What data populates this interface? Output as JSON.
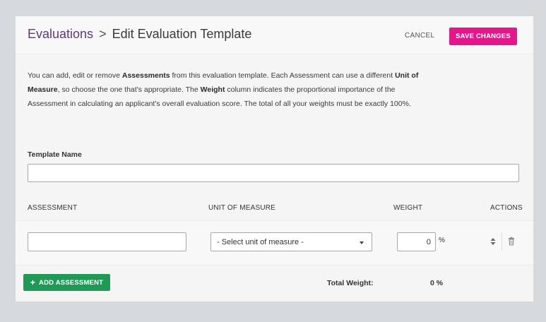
{
  "header": {
    "breadcrumb_root": "Evaluations",
    "breadcrumb_separator": ">",
    "title": "Edit Evaluation Template",
    "cancel_label": "CANCEL",
    "save_label": "SAVE CHANGES"
  },
  "description": {
    "p1": "You can add, edit or remove ",
    "b1": "Assessments",
    "p2": " from this evaluation template. Each Assessment can use a different ",
    "b2": "Unit of Measure",
    "p3": ", so choose the one that's appropriate. The ",
    "b3": "Weight",
    "p4": " column indicates the proportional importance of the Assessment in calculating an applicant's overall evaluation score. The total of all your weights must be exactly 100%."
  },
  "template_name": {
    "label": "Template Name",
    "value": ""
  },
  "columns": {
    "assessment": "ASSESSMENT",
    "unit": "UNIT OF MEASURE",
    "weight": "WEIGHT",
    "actions": "ACTIONS"
  },
  "rows": [
    {
      "assessment": "",
      "unit_selected": "- Select unit of measure -",
      "weight": "0",
      "weight_unit": "%"
    }
  ],
  "footer": {
    "add_label": "ADD ASSESSMENT",
    "add_icon": "+",
    "total_label": "Total Weight:",
    "total_value": "0 %"
  },
  "colors": {
    "save_button": "#e5168b",
    "add_button": "#1f9a56",
    "breadcrumb_link": "#5e3a74"
  },
  "icons": {
    "reorder": "sort-icon",
    "delete": "trash-icon"
  }
}
